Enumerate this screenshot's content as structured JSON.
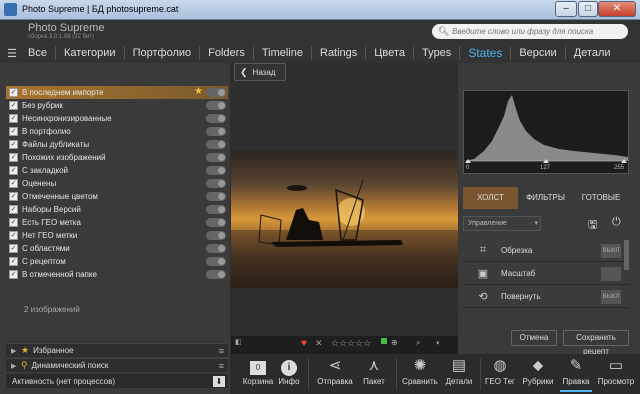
{
  "window": {
    "title": "Photo Supreme | БД photosupreme.cat",
    "min": "–",
    "max": "□",
    "close": "✕"
  },
  "header": {
    "app_name": "Photo Supreme",
    "app_sub": "сборка 3.0.1.98 (32 бит)",
    "search_placeholder": "Введите слово или фразу для поиска"
  },
  "nav": {
    "menu_icon": "☰",
    "tabs": [
      "Все",
      "Категории",
      "Портфолио",
      "Folders",
      "Timeline",
      "Ratings",
      "Цвета",
      "Types",
      "States",
      "Версии",
      "Детали"
    ],
    "active": "States"
  },
  "back": {
    "label": "Назад"
  },
  "filters": [
    {
      "label": "В последнем импорте",
      "active": true
    },
    {
      "label": "Без рубрик"
    },
    {
      "label": "Несинхронизированные"
    },
    {
      "label": "В портфолио"
    },
    {
      "label": "Файлы дубликаты"
    },
    {
      "label": "Похожих изображений"
    },
    {
      "label": "С закладкой"
    },
    {
      "label": "Оценены"
    },
    {
      "label": "Отмеченные цветом"
    },
    {
      "label": "Наборы Версий"
    },
    {
      "label": "Есть ГЕО метка"
    },
    {
      "label": "Нет ГЕО метки"
    },
    {
      "label": "С областями"
    },
    {
      "label": "С рецептом"
    },
    {
      "label": "В отмеченной папке"
    }
  ],
  "image_count": "2 изображений",
  "accordions": [
    {
      "label": "Избранное"
    },
    {
      "label": "Динамический поиск"
    }
  ],
  "activity": {
    "label": "Активность (нет процессов)"
  },
  "histogram": {
    "min": "0",
    "mid": "127",
    "max": "255"
  },
  "right_tabs": [
    "ХОЛСТ",
    "ФИЛЬТРЫ",
    "ГОТОВЫЕ"
  ],
  "right_active_tab": "ХОЛСТ",
  "preset": {
    "label": "Управление"
  },
  "tools": [
    {
      "label": "Обрезка",
      "state": "ВЫКЛ"
    },
    {
      "label": "Масштаб",
      "state": ""
    },
    {
      "label": "Повернуть",
      "state": "ВЫКЛ"
    }
  ],
  "right_buttons": {
    "cancel": "Отмена",
    "save_recipe": "Сохранить рецепт"
  },
  "toolbar": [
    {
      "label": "Корзина",
      "icon": "0"
    },
    {
      "label": "Инфо",
      "icon": "i"
    },
    {
      "label": "Отправка",
      "icon": "⋖"
    },
    {
      "label": "Пакет",
      "icon": "⋏"
    },
    {
      "label": "Сравнить",
      "icon": "✺"
    },
    {
      "label": "Детали",
      "icon": "▤"
    },
    {
      "label": "ГЕО Тег",
      "icon": "◍"
    },
    {
      "label": "Рубрики",
      "icon": "⬥"
    },
    {
      "label": "Правка",
      "icon": "✎"
    },
    {
      "label": "Просмотр",
      "icon": "▭"
    }
  ]
}
